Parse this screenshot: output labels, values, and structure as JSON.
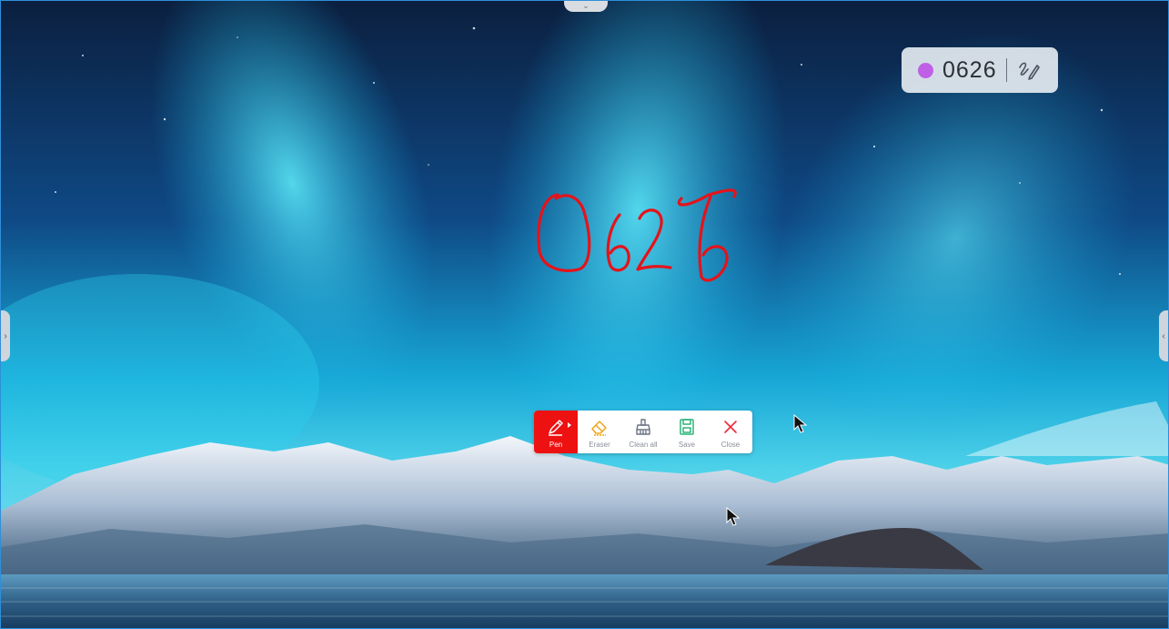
{
  "top_handle": {
    "icon": "chevron-down-icon"
  },
  "side_handles": {
    "left_icon": "chevron-right-icon",
    "right_icon": "chevron-left-icon"
  },
  "code_badge": {
    "dot_color": "#c060e6",
    "code": "0626",
    "icon": "signature-pen-icon"
  },
  "handwriting": {
    "text": "0626",
    "color": "#e5131a"
  },
  "toolbar": {
    "tools": [
      {
        "label": "Pen",
        "icon": "pen-icon",
        "active": true
      },
      {
        "label": "Eraser",
        "icon": "eraser-icon"
      },
      {
        "label": "Clean all",
        "icon": "broom-icon"
      },
      {
        "label": "Save",
        "icon": "save-icon"
      },
      {
        "label": "Close",
        "icon": "close-icon"
      }
    ],
    "active_color": "#ee1111"
  }
}
